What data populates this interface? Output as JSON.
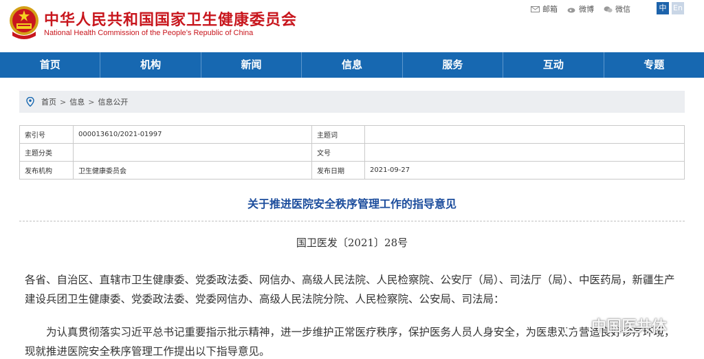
{
  "header": {
    "title_cn": "中华人民共和国国家卫生健康委员会",
    "title_en": "National Health Commission of the People’s Republic of China",
    "top_links": [
      {
        "label": "邮箱",
        "icon": "mail-icon"
      },
      {
        "label": "微博",
        "icon": "weibo-icon"
      },
      {
        "label": "微信",
        "icon": "wechat-icon"
      }
    ],
    "lang_cn": "中",
    "lang_en": "En"
  },
  "nav": [
    "首页",
    "机构",
    "新闻",
    "信息",
    "服务",
    "互动",
    "专题"
  ],
  "breadcrumb": [
    "首页",
    "信息",
    "信息公开"
  ],
  "breadcrumb_sep": ">",
  "meta": {
    "index_label": "索引号",
    "index_value": "000013610/2021-01997",
    "subject_label": "主题词",
    "subject_value": "",
    "category_label": "主题分类",
    "category_value": "",
    "docno_label": "文号",
    "docno_value": "",
    "publisher_label": "发布机构",
    "publisher_value": "卫生健康委员会",
    "date_label": "发布日期",
    "date_value": "2021-09-27"
  },
  "article": {
    "title": "关于推进医院安全秩序管理工作的指导意见",
    "doc_number": "国卫医发〔2021〕28号",
    "para1": "各省、自治区、直辖市卫生健康委、党委政法委、网信办、高级人民法院、人民检察院、公安厅（局）、司法厅（局）、中医药局，新疆生产建设兵团卫生健康委、党委政法委、党委网信办、高级人民法院分院、人民检察院、公安局、司法局：",
    "para2": "为认真贯彻落实习近平总书记重要指示批示精神，进一步维护正常医疗秩序，保护医务人员人身安全，为医患双方营造良好诊疗环境，现就推进医院安全秩序管理工作提出以下指导意见。"
  },
  "watermark": {
    "text": "中国医共体",
    "icon": "wechat-official-account-icon"
  },
  "colors": {
    "brand_red": "#c8161d",
    "nav_blue": "#1768b1",
    "title_blue": "#1b4c9c"
  }
}
